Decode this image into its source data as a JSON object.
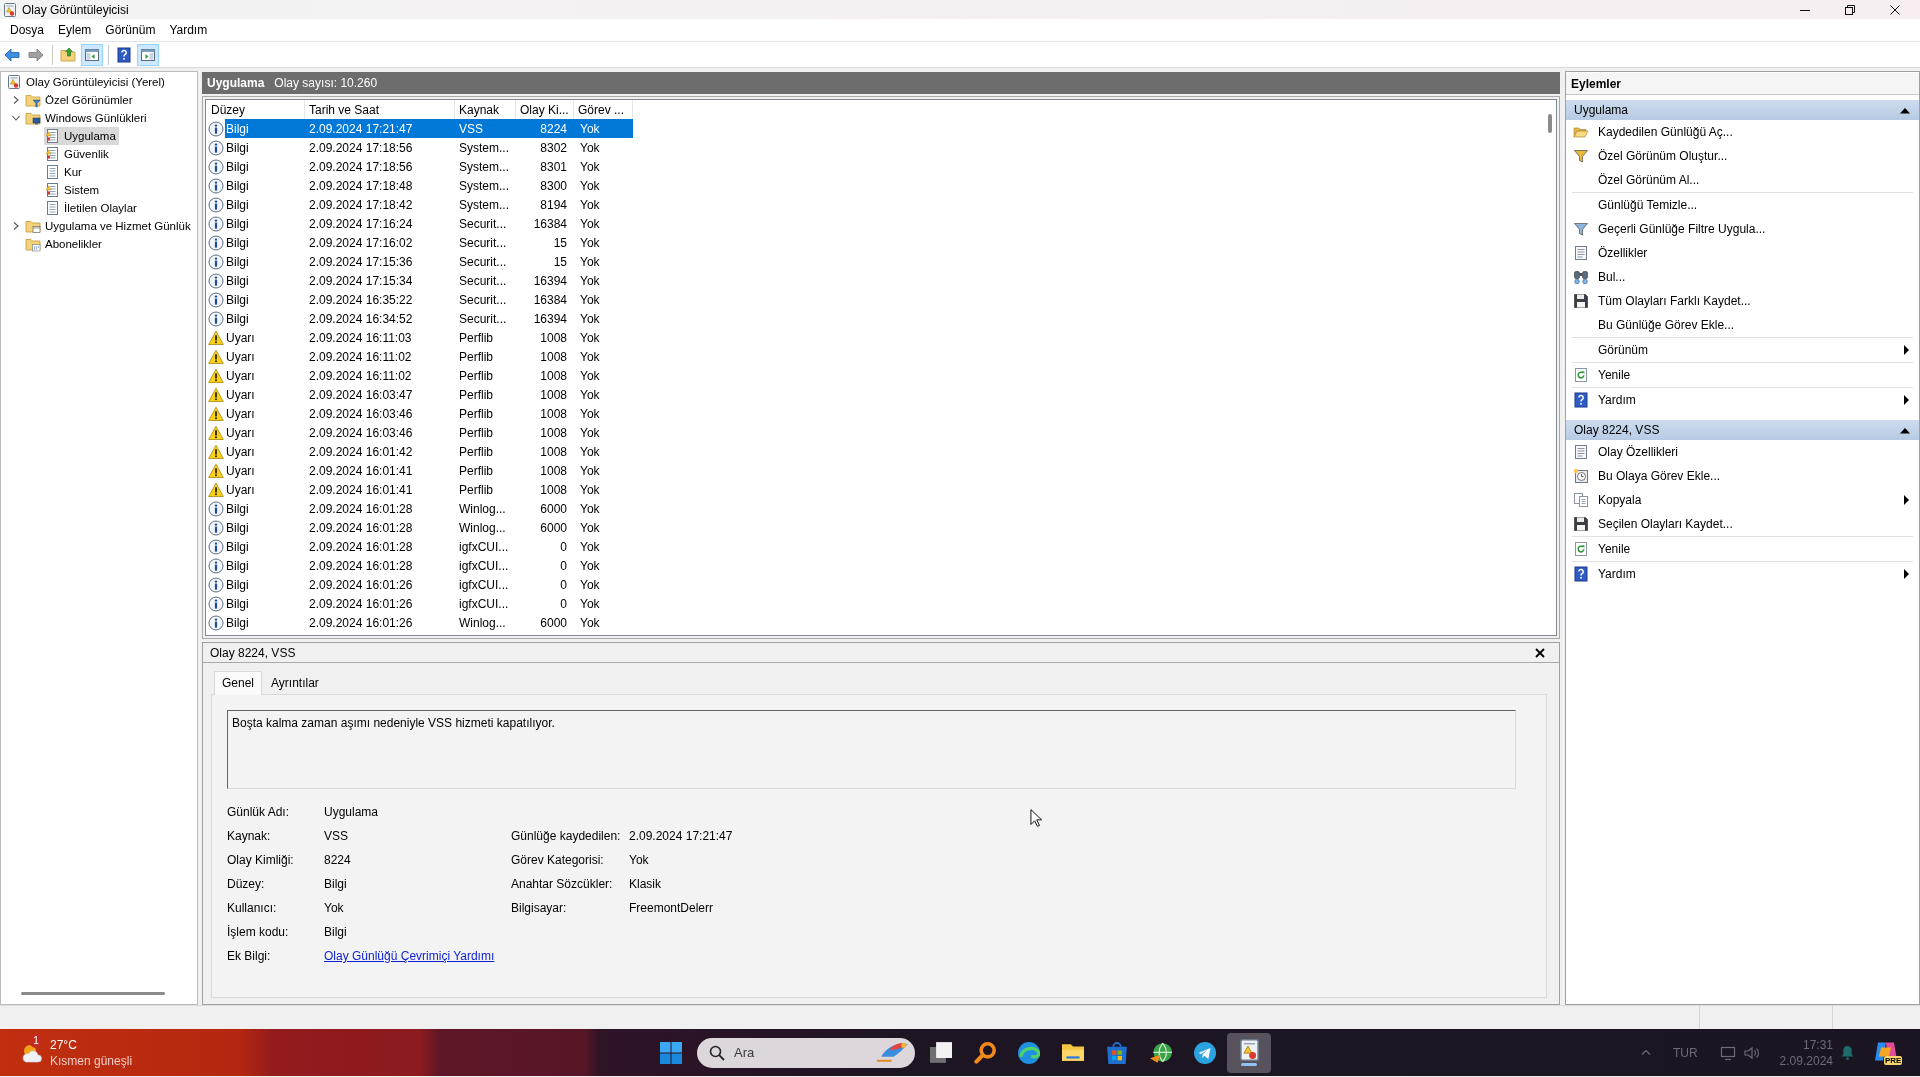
{
  "window": {
    "title": "Olay Görüntüleyicisi"
  },
  "menu": [
    {
      "label": "Dosya"
    },
    {
      "label": "Eylem"
    },
    {
      "label": "Görünüm"
    },
    {
      "label": "Yardım"
    }
  ],
  "toolbar": {
    "groups": [
      [
        {
          "kind": "back",
          "disabled": false
        },
        {
          "kind": "forward",
          "disabled": true
        }
      ],
      [
        {
          "kind": "up",
          "on": false
        },
        {
          "kind": "show-tree",
          "on": true
        }
      ],
      [
        {
          "kind": "help",
          "on": false
        },
        {
          "kind": "show-actions",
          "on": true
        }
      ]
    ]
  },
  "tree": {
    "items": [
      {
        "label": "Olay Görüntüleyicisi (Yerel)",
        "kind": "root",
        "selected": false,
        "children": [
          {
            "label": "Özel Görünümler",
            "kind": "filter-folder",
            "expanded": false,
            "selected": false
          },
          {
            "label": "Windows Günlükleri",
            "kind": "computer-folder",
            "expanded": true,
            "selected": false,
            "children": [
              {
                "label": "Uygulama",
                "kind": "log-alert",
                "selected": true
              },
              {
                "label": "Güvenlik",
                "kind": "log-alert",
                "selected": false
              },
              {
                "label": "Kur",
                "kind": "log",
                "selected": false
              },
              {
                "label": "Sistem",
                "kind": "log-alert",
                "selected": false
              },
              {
                "label": "İletilen Olaylar",
                "kind": "log",
                "selected": false
              }
            ]
          },
          {
            "label": "Uygulama ve Hizmet Günlük",
            "kind": "window-folder",
            "expanded": false,
            "selected": false
          },
          {
            "label": "Abonelikler",
            "kind": "calendar-folder",
            "selected": false
          }
        ]
      }
    ]
  },
  "events": {
    "title": "Uygulama",
    "count": "Olay sayısı: 10.260",
    "columns": [
      "Düzey",
      "Tarih ve Saat",
      "Kaynak",
      "Olay Ki...",
      "Görev ..."
    ],
    "rows": [
      {
        "kind": "info",
        "selected": true,
        "cells": [
          "Bilgi",
          "2.09.2024 17:21:47",
          "VSS",
          "8224",
          "Yok"
        ]
      },
      {
        "kind": "info",
        "selected": false,
        "cells": [
          "Bilgi",
          "2.09.2024 17:18:56",
          "System...",
          "8302",
          "Yok"
        ]
      },
      {
        "kind": "info",
        "selected": false,
        "cells": [
          "Bilgi",
          "2.09.2024 17:18:56",
          "System...",
          "8301",
          "Yok"
        ]
      },
      {
        "kind": "info",
        "selected": false,
        "cells": [
          "Bilgi",
          "2.09.2024 17:18:48",
          "System...",
          "8300",
          "Yok"
        ]
      },
      {
        "kind": "info",
        "selected": false,
        "cells": [
          "Bilgi",
          "2.09.2024 17:18:42",
          "System...",
          "8194",
          "Yok"
        ]
      },
      {
        "kind": "info",
        "selected": false,
        "cells": [
          "Bilgi",
          "2.09.2024 17:16:24",
          "Securit...",
          "16384",
          "Yok"
        ]
      },
      {
        "kind": "info",
        "selected": false,
        "cells": [
          "Bilgi",
          "2.09.2024 17:16:02",
          "Securit...",
          "15",
          "Yok"
        ]
      },
      {
        "kind": "info",
        "selected": false,
        "cells": [
          "Bilgi",
          "2.09.2024 17:15:36",
          "Securit...",
          "15",
          "Yok"
        ]
      },
      {
        "kind": "info",
        "selected": false,
        "cells": [
          "Bilgi",
          "2.09.2024 17:15:34",
          "Securit...",
          "16394",
          "Yok"
        ]
      },
      {
        "kind": "info",
        "selected": false,
        "cells": [
          "Bilgi",
          "2.09.2024 16:35:22",
          "Securit...",
          "16384",
          "Yok"
        ]
      },
      {
        "kind": "info",
        "selected": false,
        "cells": [
          "Bilgi",
          "2.09.2024 16:34:52",
          "Securit...",
          "16394",
          "Yok"
        ]
      },
      {
        "kind": "warning",
        "selected": false,
        "cells": [
          "Uyarı",
          "2.09.2024 16:11:03",
          "Perflib",
          "1008",
          "Yok"
        ]
      },
      {
        "kind": "warning",
        "selected": false,
        "cells": [
          "Uyarı",
          "2.09.2024 16:11:02",
          "Perflib",
          "1008",
          "Yok"
        ]
      },
      {
        "kind": "warning",
        "selected": false,
        "cells": [
          "Uyarı",
          "2.09.2024 16:11:02",
          "Perflib",
          "1008",
          "Yok"
        ]
      },
      {
        "kind": "warning",
        "selected": false,
        "cells": [
          "Uyarı",
          "2.09.2024 16:03:47",
          "Perflib",
          "1008",
          "Yok"
        ]
      },
      {
        "kind": "warning",
        "selected": false,
        "cells": [
          "Uyarı",
          "2.09.2024 16:03:46",
          "Perflib",
          "1008",
          "Yok"
        ]
      },
      {
        "kind": "warning",
        "selected": false,
        "cells": [
          "Uyarı",
          "2.09.2024 16:03:46",
          "Perflib",
          "1008",
          "Yok"
        ]
      },
      {
        "kind": "warning",
        "selected": false,
        "cells": [
          "Uyarı",
          "2.09.2024 16:01:42",
          "Perflib",
          "1008",
          "Yok"
        ]
      },
      {
        "kind": "warning",
        "selected": false,
        "cells": [
          "Uyarı",
          "2.09.2024 16:01:41",
          "Perflib",
          "1008",
          "Yok"
        ]
      },
      {
        "kind": "warning",
        "selected": false,
        "cells": [
          "Uyarı",
          "2.09.2024 16:01:41",
          "Perflib",
          "1008",
          "Yok"
        ]
      },
      {
        "kind": "info",
        "selected": false,
        "cells": [
          "Bilgi",
          "2.09.2024 16:01:28",
          "Winlog...",
          "6000",
          "Yok"
        ]
      },
      {
        "kind": "info",
        "selected": false,
        "cells": [
          "Bilgi",
          "2.09.2024 16:01:28",
          "Winlog...",
          "6000",
          "Yok"
        ]
      },
      {
        "kind": "info",
        "selected": false,
        "cells": [
          "Bilgi",
          "2.09.2024 16:01:28",
          "igfxCUI...",
          "0",
          "Yok"
        ]
      },
      {
        "kind": "info",
        "selected": false,
        "cells": [
          "Bilgi",
          "2.09.2024 16:01:28",
          "igfxCUI...",
          "0",
          "Yok"
        ]
      },
      {
        "kind": "info",
        "selected": false,
        "cells": [
          "Bilgi",
          "2.09.2024 16:01:26",
          "igfxCUI...",
          "0",
          "Yok"
        ]
      },
      {
        "kind": "info",
        "selected": false,
        "cells": [
          "Bilgi",
          "2.09.2024 16:01:26",
          "igfxCUI...",
          "0",
          "Yok"
        ]
      },
      {
        "kind": "info",
        "selected": false,
        "cells": [
          "Bilgi",
          "2.09.2024 16:01:26",
          "Winlog...",
          "6000",
          "Yok"
        ]
      }
    ]
  },
  "detail": {
    "title": "Olay 8224, VSS",
    "tabs": [
      {
        "label": "Genel",
        "selected": true
      },
      {
        "label": "Ayrıntılar",
        "selected": false
      }
    ],
    "message": "Boşta kalma zaman aşımı nedeniyle VSS hizmeti kapatılıyor.",
    "properties": [
      [
        {
          "label": "Günlük Adı:",
          "value": "Uygulama"
        }
      ],
      [
        {
          "label": "Kaynak:",
          "value": "VSS"
        },
        {
          "label": "Günlüğe kaydedilen:",
          "value": "2.09.2024 17:21:47"
        }
      ],
      [
        {
          "label": "Olay Kimliği:",
          "value": "8224"
        },
        {
          "label": "Görev Kategorisi:",
          "value": "Yok"
        }
      ],
      [
        {
          "label": "Düzey:",
          "value": "Bilgi"
        },
        {
          "label": "Anahtar Sözcükler:",
          "value": "Klasik"
        }
      ],
      [
        {
          "label": "Kullanıcı:",
          "value": "Yok"
        },
        {
          "label": "Bilgisayar:",
          "value": "FreemontDelerr"
        }
      ],
      [
        {
          "label": "İşlem kodu:",
          "value": "Bilgi"
        }
      ],
      [
        {
          "label": "Ek Bilgi:",
          "link": "Olay Günlüğü Çevrimiçi Yardımı"
        }
      ]
    ]
  },
  "actions": {
    "title": "Eylemler",
    "sections": [
      {
        "title": "Uygulama",
        "expanded": true,
        "groups": [
          [
            {
              "label": "Kaydedilen Günlüğü Aç...",
              "kind": "folder-open",
              "submenu": false
            },
            {
              "label": "Özel Görünüm Oluştur...",
              "kind": "filter-new",
              "submenu": false
            },
            {
              "label": "Özel Görünüm Al...",
              "kind": "text",
              "submenu": false
            }
          ],
          [
            {
              "label": "Günlüğü Temizle...",
              "kind": "text",
              "submenu": false
            },
            {
              "label": "Geçerli Günlüğe Filtre Uygula...",
              "kind": "filter",
              "submenu": false
            },
            {
              "label": "Özellikler",
              "kind": "properties",
              "submenu": false
            },
            {
              "label": "Bul...",
              "kind": "find",
              "submenu": false
            },
            {
              "label": "Tüm Olayları Farklı Kaydet...",
              "kind": "save",
              "submenu": false
            },
            {
              "label": "Bu Günlüğe Görev Ekle...",
              "kind": "text",
              "submenu": false
            }
          ],
          [
            {
              "label": "Görünüm",
              "kind": "text",
              "submenu": true
            }
          ],
          [
            {
              "label": "Yenile",
              "kind": "refresh",
              "submenu": false
            }
          ],
          [
            {
              "label": "Yardım",
              "kind": "help",
              "submenu": true
            }
          ]
        ]
      },
      {
        "title": "Olay 8224, VSS",
        "expanded": true,
        "groups": [
          [
            {
              "label": "Olay Özellikleri",
              "kind": "properties",
              "submenu": false
            },
            {
              "label": "Bu Olaya Görev Ekle...",
              "kind": "task",
              "submenu": false
            },
            {
              "label": "Kopyala",
              "kind": "copy",
              "submenu": true
            },
            {
              "label": "Seçilen Olayları Kaydet...",
              "kind": "save",
              "submenu": false
            }
          ],
          [
            {
              "label": "Yenile",
              "kind": "refresh",
              "submenu": false
            }
          ],
          [
            {
              "label": "Yardım",
              "kind": "help",
              "submenu": true
            }
          ]
        ]
      }
    ]
  },
  "taskbar": {
    "weather": {
      "badge": "1",
      "temperature": "27°C",
      "condition": "Kısmen güneşli"
    },
    "search": {
      "placeholder": "Ara"
    },
    "apps": [
      {
        "kind": "task-view",
        "active": false
      },
      {
        "kind": "magnifier",
        "active": false
      },
      {
        "kind": "browser",
        "active": false
      },
      {
        "kind": "folder",
        "active": false
      },
      {
        "kind": "store",
        "active": false
      },
      {
        "kind": "globe",
        "active": false
      },
      {
        "kind": "plane",
        "active": false
      },
      {
        "kind": "event-viewer",
        "active": true
      }
    ],
    "tray": {
      "language": "TUR",
      "time": "17:31",
      "date": "2.09.2024",
      "badge": "PRE"
    }
  }
}
